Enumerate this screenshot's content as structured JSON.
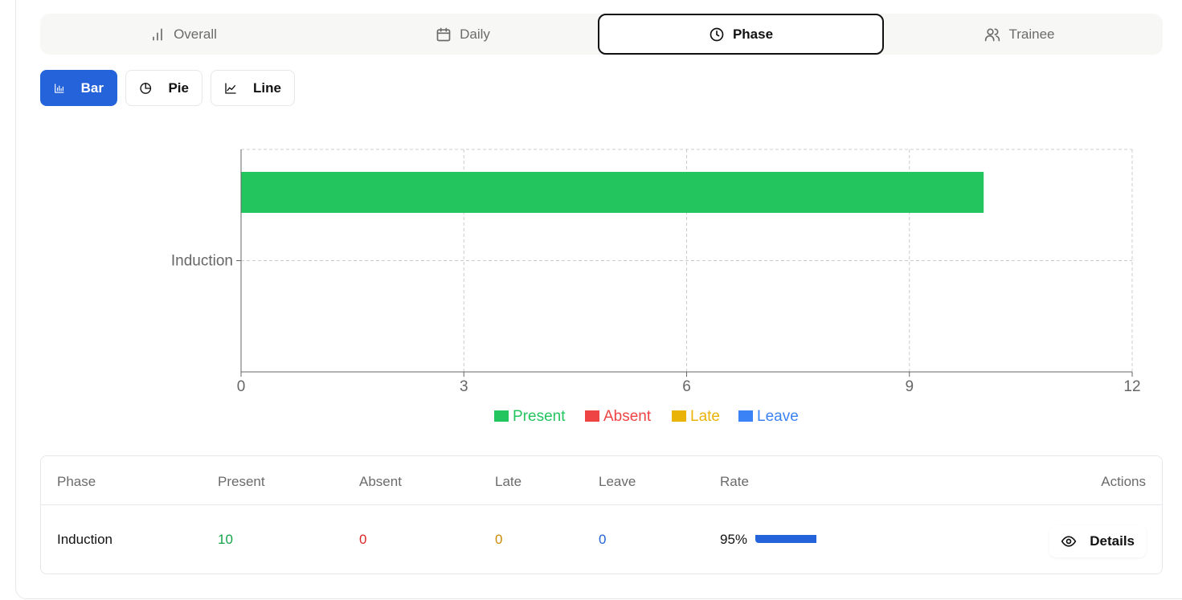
{
  "tabs": [
    {
      "label": "Overall",
      "icon": "bar-chart-icon"
    },
    {
      "label": "Daily",
      "icon": "calendar-icon"
    },
    {
      "label": "Phase",
      "icon": "clock-icon"
    },
    {
      "label": "Trainee",
      "icon": "users-icon"
    }
  ],
  "active_tab": "Phase",
  "view_buttons": [
    {
      "label": "Bar",
      "icon": "bar-chart-icon"
    },
    {
      "label": "Pie",
      "icon": "pie-chart-icon"
    },
    {
      "label": "Line",
      "icon": "line-chart-icon"
    }
  ],
  "active_view": "Bar",
  "colors": {
    "present": "#22c55e",
    "absent": "#ef4444",
    "late": "#eab308",
    "leave": "#3b82f6",
    "accent": "#2563db"
  },
  "chart_data": {
    "type": "bar",
    "orientation": "horizontal",
    "categories": [
      "Induction"
    ],
    "series": [
      {
        "name": "Present",
        "values": [
          10
        ]
      },
      {
        "name": "Absent",
        "values": [
          0
        ]
      },
      {
        "name": "Late",
        "values": [
          0
        ]
      },
      {
        "name": "Leave",
        "values": [
          0
        ]
      }
    ],
    "xlim": [
      0,
      12
    ],
    "xticks": [
      0,
      3,
      6,
      9,
      12
    ],
    "grid": true,
    "legend": "bottom"
  },
  "table": {
    "headers": {
      "phase": "Phase",
      "present": "Present",
      "absent": "Absent",
      "late": "Late",
      "leave": "Leave",
      "rate": "Rate",
      "actions": "Actions"
    },
    "rows": [
      {
        "phase": "Induction",
        "present": "10",
        "absent": "0",
        "late": "0",
        "leave": "0",
        "rate": "95%",
        "rate_value": 95,
        "action_label": "Details"
      }
    ]
  }
}
